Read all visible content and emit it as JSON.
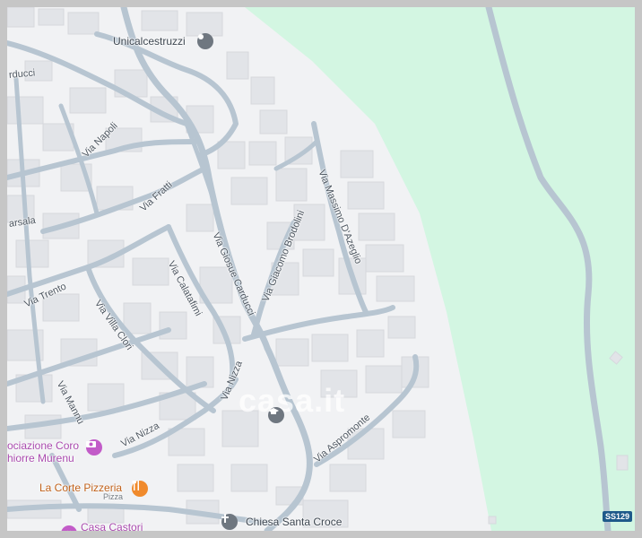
{
  "map": {
    "colors": {
      "background": "#f1f2f4",
      "park": "#d3f6e2",
      "road": "#b7c5d1",
      "building": "#e2e4e8",
      "poi_gray": "#6f7780",
      "poi_pink": "#c25bc8",
      "poi_orange": "#f08a2c",
      "highway_badge": "#1e5a8a"
    },
    "pois": {
      "unicalcestruzzi": {
        "label": "Unicalcestruzzi",
        "icon": "map-pin-icon"
      },
      "associazione": {
        "label_line1": "ociazione Coro",
        "label_line2": "hiorre Murenu",
        "icon": "camera-icon"
      },
      "la_corte": {
        "label": "La Corte Pizzeria",
        "sublabel": "Pizza",
        "icon": "fork-knife-icon"
      },
      "casa_castori": {
        "label": "Casa Castori",
        "icon": "heart-icon"
      },
      "chiesa": {
        "label": "Chiesa Santa Croce",
        "icon": "cross-icon"
      },
      "school": {
        "label": "",
        "icon": "graduation-cap-icon"
      }
    },
    "streets": {
      "via_napoli": "Via Napoli",
      "via_fratti": "Via Fratti",
      "via_trento": "Via Trento",
      "via_villa_clori": "Via Villa Clori",
      "via_calatafimi": "Via Calatafimi",
      "via_giosue_carducci": "Via Giosue Carducci",
      "via_giacomo_brodolini": "Via Giacomo Brodolini",
      "via_massimo_dazeglio": "Via Massimo D'Azeglio",
      "via_nizza_1": "Via Nizza",
      "via_nizza_2": "Via Nizza",
      "via_mannu": "Via Mannu",
      "via_aspromonte": "Via Aspromonte",
      "carducci_edge": "rducci",
      "marsala_edge": "arsala"
    },
    "highway": {
      "label": "SS129"
    },
    "watermark": "casa.it"
  }
}
